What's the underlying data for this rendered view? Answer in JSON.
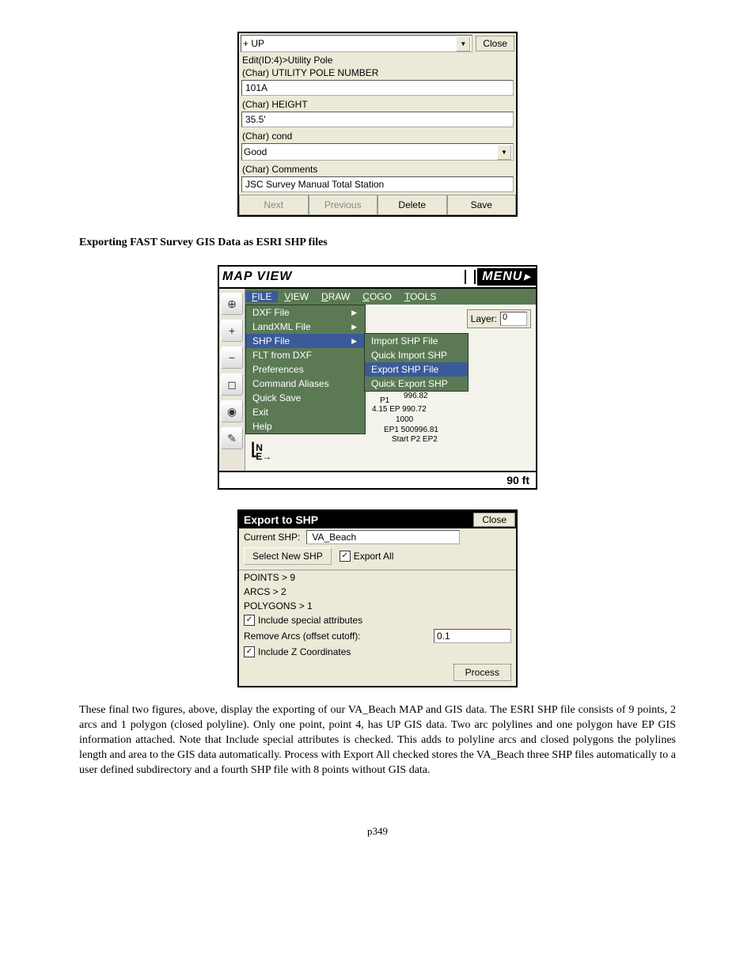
{
  "dialog1": {
    "combo_text": "+ UP",
    "close": "Close",
    "edit_line": "Edit(ID:4)>Utility Pole",
    "f1_label": "(Char) UTILITY POLE NUMBER",
    "f1_value": "101A",
    "f2_label": "(Char) HEIGHT",
    "f2_value": "35.5'",
    "f3_label": "(Char) cond",
    "f3_value": "Good",
    "f4_label": "(Char) Comments",
    "f4_value": "JSC Survey Manual Total Station",
    "btn_next": "Next",
    "btn_prev": "Previous",
    "btn_delete": "Delete",
    "btn_save": "Save"
  },
  "heading": "Exporting FAST Survey GIS Data as ESRI SHP files",
  "mapview": {
    "title": "MAP VIEW",
    "menu_btn": "MENU",
    "menubar": {
      "file": "FILE",
      "view": "VIEW",
      "draw": "DRAW",
      "cogo": "COGO",
      "tools": "TOOLS"
    },
    "file_menu": [
      "DXF File",
      "LandXML File",
      "SHP File",
      "FLT from DXF",
      "Preferences",
      "Command Aliases",
      "Quick Save",
      "Exit",
      "Help"
    ],
    "shp_submenu": [
      "Import SHP File",
      "Quick Import SHP",
      "Export SHP File",
      "Quick Export SHP"
    ],
    "layer_label": "Layer:",
    "layer_value": "0",
    "canvas_labels": [
      "996.82",
      "4.15 EP 990.72",
      "1000",
      "EP1 500996.81",
      "Start P2 EP2",
      "P1"
    ],
    "north": "N",
    "east": "E→",
    "scale": "90 ft"
  },
  "export": {
    "title": "Export to SHP",
    "close": "Close",
    "current_label": "Current SHP:",
    "current_value": "VA_Beach",
    "select_new": "Select New SHP",
    "export_all": "Export All",
    "points": "POINTS > 9",
    "arcs": "ARCS > 2",
    "polygons": "POLYGONS > 1",
    "include_special": "Include special attributes",
    "remove_arcs": "Remove Arcs (offset cutoff):",
    "remove_arcs_val": "0.1",
    "include_z": "Include Z Coordinates",
    "process": "Process"
  },
  "body_text": "These final two figures, above, display the exporting of our VA_Beach MAP and GIS data.  The ESRI SHP file consists of 9 points, 2 arcs and 1 polygon (closed polyline).  Only one point, point 4, has UP GIS data.  Two arc polylines and one polygon have EP GIS information attached.  Note that Include special attributes is checked. This adds to polyline arcs and closed polygons the polylines length and area to the GIS data automatically.  Process with Export All checked stores the VA_Beach three SHP files automatically to a user defined subdirectory and a fourth SHP file with 8 points without GIS data.",
  "pagenum": "p349"
}
